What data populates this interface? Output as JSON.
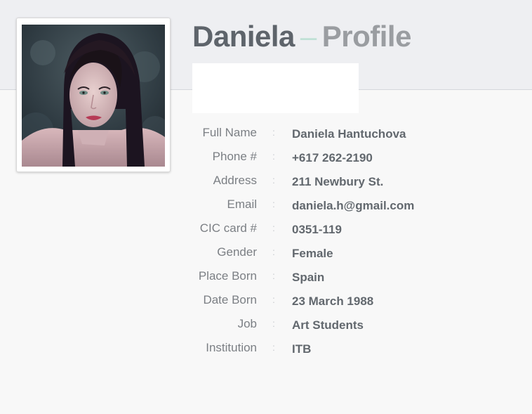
{
  "profile": {
    "name": "Daniela",
    "dash": "–",
    "section": "Profile"
  },
  "colors": {
    "header_band": "#eeeff2",
    "name_text": "#5e646b",
    "dash_accent": "#bfe0d6",
    "section_text": "#9a9da1",
    "label_text": "#7b7f84",
    "value_text": "#62686e"
  },
  "details": [
    {
      "label": "Full Name",
      "value": "Daniela Hantuchova"
    },
    {
      "label": "Phone #",
      "value": "+617 262-2190"
    },
    {
      "label": "Address",
      "value": "211 Newbury St."
    },
    {
      "label": "Email",
      "value": "daniela.h@gmail.com"
    },
    {
      "label": "CIC card #",
      "value": "0351-119"
    },
    {
      "label": "Gender",
      "value": "Female"
    },
    {
      "label": "Place Born",
      "value": "Spain"
    },
    {
      "label": "Date Born",
      "value": "23 March 1988"
    },
    {
      "label": "Job",
      "value": "Art Students"
    },
    {
      "label": "Institution",
      "value": "ITB"
    }
  ],
  "separator": ":"
}
